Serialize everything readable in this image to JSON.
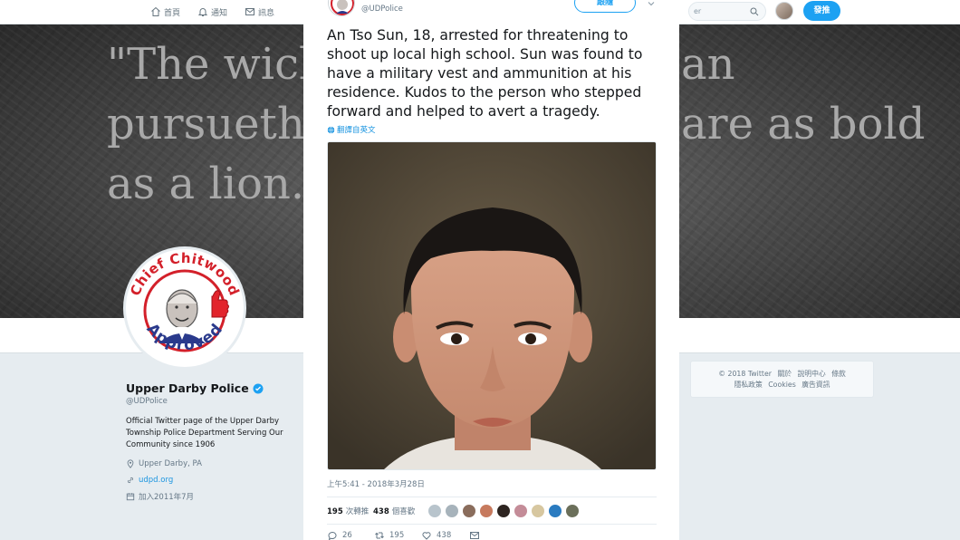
{
  "nav": {
    "home": "首頁",
    "notifications": "通知",
    "messages": "訊息",
    "search_placeholder": "er",
    "tweet_button": "發推"
  },
  "banner": {
    "quote_line1_a": "\"The wick",
    "quote_line1_b": "an",
    "quote_line2_a": "pursueth,",
    "quote_line2_b": "are as bold",
    "quote_line3": "as a lion.\""
  },
  "avatar_badge": {
    "top_text": "Chief Chitwood",
    "bottom_text": "Approved"
  },
  "profile": {
    "name": "Upper Darby Police",
    "handle": "@UDPolice",
    "bio_lines": [
      "Official Twitter page of the Upper Darby",
      "Township Police Department Serving Our",
      "Community since 1906"
    ],
    "location": "Upper Darby, PA",
    "website": "udpd.org",
    "joined": "加入2011年7月"
  },
  "footer": {
    "line1": [
      "© 2018 Twitter",
      "關於",
      "說明中心",
      "條款"
    ],
    "line2": [
      "隱私政策",
      "Cookies",
      "廣告資訊"
    ]
  },
  "tweet": {
    "handle": "@UDPolice",
    "follow_label": "跟隨",
    "text_lines": [
      "An Tso Sun, 18, arrested for threatening to",
      "shoot up local high school.  Sun was found to",
      "have a military vest and ammunition at his",
      "residence. Kudos to the person who stepped",
      "forward and helped to avert a tragedy."
    ],
    "translate_label": "翻譯自英文",
    "timestamp": "上午5:41 - 2018年3月28日",
    "retweets_count": "195",
    "retweets_label": "次轉推",
    "likes_count": "438",
    "likes_label": "個喜歡",
    "reply_count": "26",
    "retweet_action_count": "195",
    "like_action_count": "438"
  },
  "colors": {
    "accent": "#1da1f2",
    "link": "#1b95e0",
    "badge_red": "#d3202a",
    "badge_blue": "#2a3a8c"
  }
}
